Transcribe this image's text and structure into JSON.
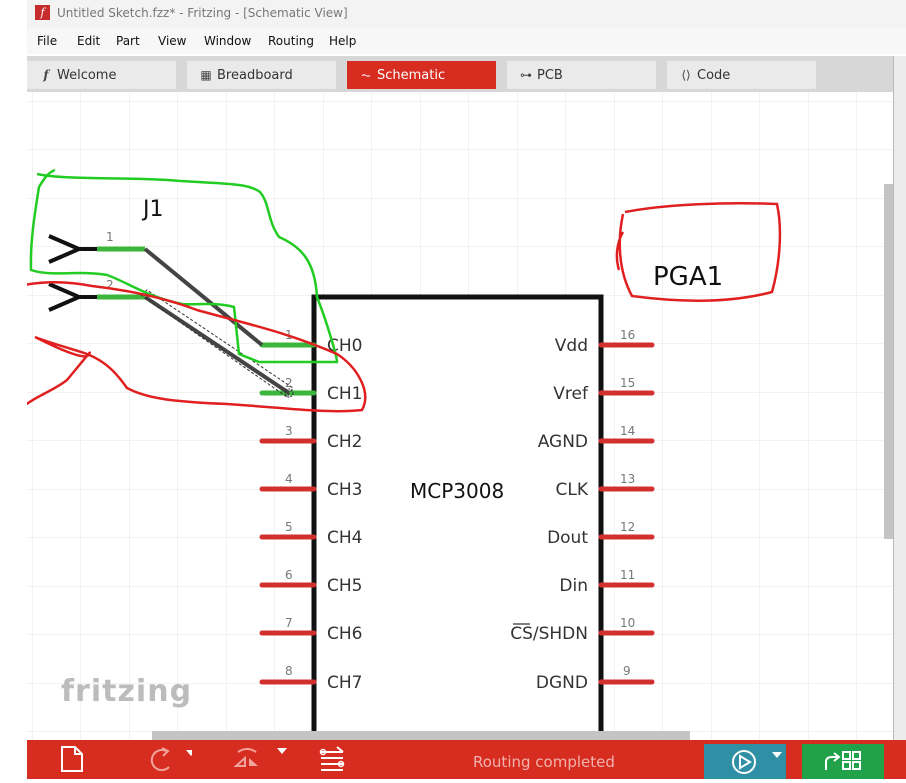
{
  "window": {
    "title": "Untitled Sketch.fzz* - Fritzing - [Schematic View]",
    "app_icon_glyph": "f"
  },
  "menu": [
    "File",
    "Edit",
    "Part",
    "View",
    "Window",
    "Routing",
    "Help"
  ],
  "tabs": [
    {
      "label": "Welcome",
      "icon": "fritzing-f-icon",
      "glyph": "f"
    },
    {
      "label": "Breadboard",
      "icon": "breadboard-icon",
      "glyph": "▦"
    },
    {
      "label": "Schematic",
      "icon": "resistor-icon",
      "glyph": "⏦"
    },
    {
      "label": "PCB",
      "icon": "pcb-icon",
      "glyph": "⊶"
    },
    {
      "label": "Code",
      "icon": "code-icon",
      "glyph": "⟨⟩"
    }
  ],
  "schematic": {
    "connector_label": "J1",
    "connector_pins": [
      "1",
      "2"
    ],
    "chip_name": "MCP3008",
    "annotation": "PGA1",
    "left_pins": [
      {
        "num": "1",
        "name": "CH0"
      },
      {
        "num": "2",
        "name": "CH1"
      },
      {
        "num": "3",
        "name": "CH2"
      },
      {
        "num": "4",
        "name": "CH3"
      },
      {
        "num": "5",
        "name": "CH4"
      },
      {
        "num": "6",
        "name": "CH5"
      },
      {
        "num": "7",
        "name": "CH6"
      },
      {
        "num": "8",
        "name": "CH7"
      }
    ],
    "right_pins": [
      {
        "num": "16",
        "name": "Vdd"
      },
      {
        "num": "15",
        "name": "Vref"
      },
      {
        "num": "14",
        "name": "AGND"
      },
      {
        "num": "13",
        "name": "CLK"
      },
      {
        "num": "12",
        "name": "Dout"
      },
      {
        "num": "11",
        "name": "Din"
      },
      {
        "num": "10",
        "name": "CS/SHDN"
      },
      {
        "num": "9",
        "name": "DGND"
      }
    ],
    "watermark": "fritzing"
  },
  "toolbar": {
    "status": "Routing completed",
    "icons": [
      "new-sketch-icon",
      "rotate-icon",
      "flip-icon",
      "autoroute-icon",
      "share-icon",
      "export-icon"
    ]
  },
  "colors": {
    "accent_red": "#d62d20",
    "share_blue": "#2e8fa5",
    "export_green": "#20a14a",
    "pin_red": "#d32f2f",
    "pin_green": "#3cb53c",
    "wire": "#444444",
    "annotation_red": "#e02020",
    "annotation_green": "#22cc22"
  }
}
